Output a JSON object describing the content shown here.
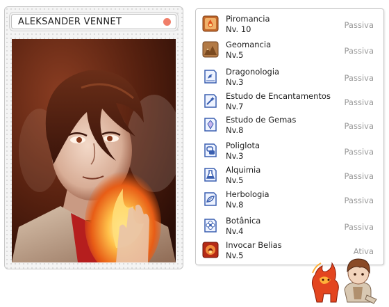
{
  "character": {
    "name": "ALEKSANDER VENNET",
    "status_color": "#f07e69"
  },
  "skills": [
    {
      "name": "Piromancia",
      "level": "Nv. 10",
      "type": "Passiva",
      "icon": "fire-scroll-icon"
    },
    {
      "name": "Geomancia",
      "level": "Nv.5",
      "type": "Passiva",
      "icon": "earth-scroll-icon"
    },
    {
      "name": "Dragonologia",
      "level": "Nv.3",
      "type": "Passiva",
      "icon": "dragon-book-icon"
    },
    {
      "name": "Estudo de Encantamentos",
      "level": "Nv.7",
      "type": "Passiva",
      "icon": "enchant-book-icon"
    },
    {
      "name": "Estudo de Gemas",
      "level": "Nv.8",
      "type": "Passiva",
      "icon": "gem-book-icon"
    },
    {
      "name": "Poliglota",
      "level": "Nv.3",
      "type": "Passiva",
      "icon": "language-book-icon"
    },
    {
      "name": "Alquimia",
      "level": "Nv.5",
      "type": "Passiva",
      "icon": "potion-book-icon"
    },
    {
      "name": "Herbologia",
      "level": "Nv.8",
      "type": "Passiva",
      "icon": "herb-book-icon"
    },
    {
      "name": "Botânica",
      "level": "Nv.4",
      "type": "Passiva",
      "icon": "flower-book-icon"
    },
    {
      "name": "Invocar Belias",
      "level": "Nv.5",
      "type": "Ativa",
      "icon": "summon-icon"
    }
  ],
  "colors": {
    "book_blue": "#3a5fb0",
    "fire_red": "#c0301c",
    "scroll_brown": "#a4683a"
  }
}
